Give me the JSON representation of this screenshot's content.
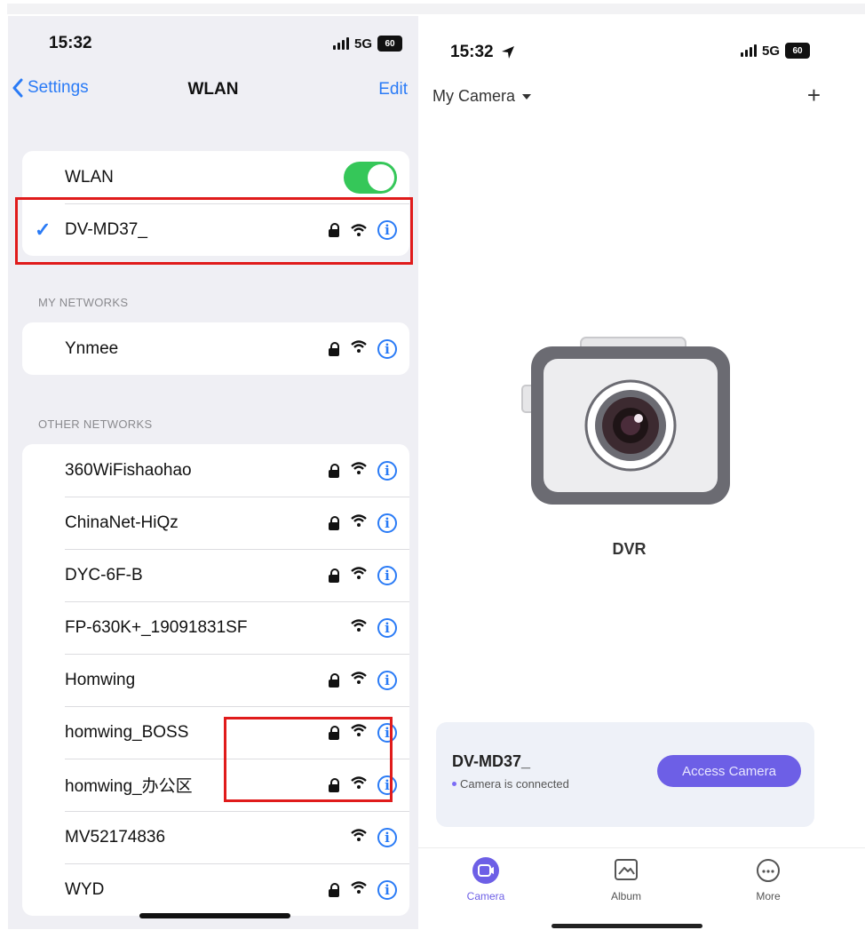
{
  "left": {
    "status": {
      "time": "15:32",
      "network": "5G",
      "battery": "60"
    },
    "nav": {
      "back_label": "Settings",
      "title": "WLAN",
      "edit_label": "Edit"
    },
    "wlan_toggle_label": "WLAN",
    "wlan_toggle_on": true,
    "connected_network": "DV-MD37_",
    "my_networks_header": "MY NETWORKS",
    "my_networks": [
      {
        "name": "Ynmee",
        "locked": true
      }
    ],
    "other_networks_header": "OTHER NETWORKS",
    "other_networks": [
      {
        "name": "360WiFishaohao",
        "locked": true
      },
      {
        "name": "ChinaNet-HiQz",
        "locked": true
      },
      {
        "name": "DYC-6F-B",
        "locked": true
      },
      {
        "name": "FP-630K+_19091831SF",
        "locked": false
      },
      {
        "name": "Homwing",
        "locked": true
      },
      {
        "name": "homwing_BOSS",
        "locked": true
      },
      {
        "name": "homwing_办公区",
        "locked": true
      },
      {
        "name": "MV52174836",
        "locked": false
      },
      {
        "name": "WYD",
        "locked": true
      }
    ]
  },
  "right": {
    "status": {
      "time": "15:32",
      "network": "5G",
      "battery": "60"
    },
    "header": {
      "title": "My Camera",
      "add_label": "+"
    },
    "device_label": "DVR",
    "card": {
      "device_name": "DV-MD37_",
      "status": "Camera is connected",
      "button_label": "Access Camera"
    },
    "tabs": [
      {
        "label": "Camera",
        "icon": "camera-icon",
        "active": true
      },
      {
        "label": "Album",
        "icon": "album-icon",
        "active": false
      },
      {
        "label": "More",
        "icon": "more-icon",
        "active": false
      }
    ]
  },
  "colors": {
    "ios_blue": "#2a7bf6",
    "toggle_green": "#35c759",
    "accent_purple": "#6d5fe6",
    "highlight_red": "#e01b1b"
  }
}
